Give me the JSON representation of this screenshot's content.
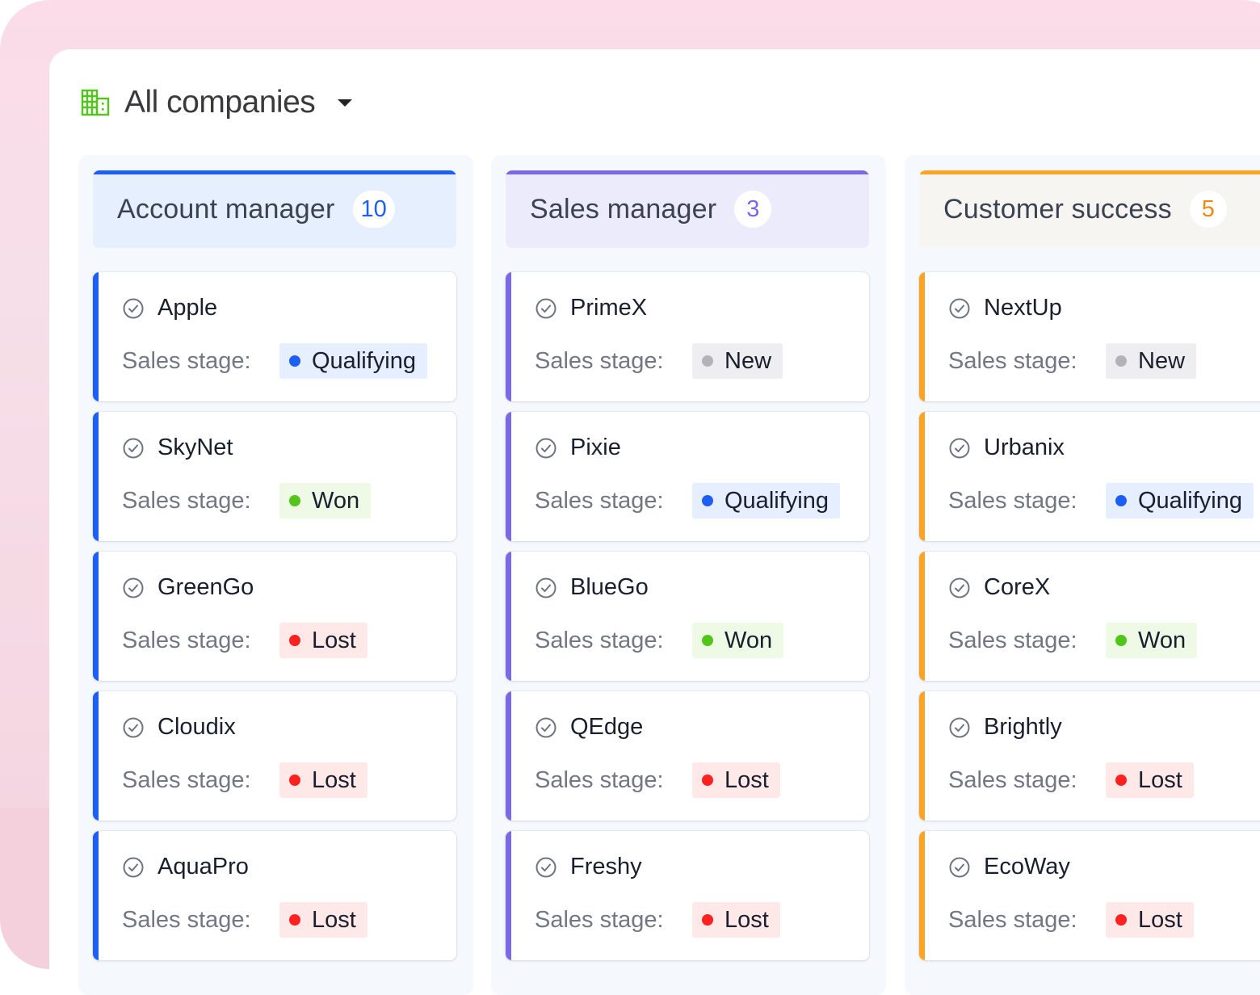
{
  "header": {
    "title": "All companies",
    "icon": "building-icon",
    "icon_color": "#52c41a",
    "dropdown_icon": "caret-down-icon"
  },
  "stage_styles": {
    "Qualifying": {
      "dot": "#1d5ef5",
      "bg": "#e6efff"
    },
    "Won": {
      "dot": "#52c41a",
      "bg": "#eefae6"
    },
    "Lost": {
      "dot": "#ff2020",
      "bg": "#ffe8e8"
    },
    "New": {
      "dot": "#b2b3b8",
      "bg": "#eeeef0"
    }
  },
  "columns": [
    {
      "title": "Account manager",
      "count": "10",
      "accent": "#1d5ef5",
      "header_bg": "#e6effe",
      "count_color": "#1d5ef5",
      "cards": [
        {
          "name": "Apple",
          "stage_label": "Sales stage:",
          "stage": "Qualifying"
        },
        {
          "name": "SkyNet",
          "stage_label": "Sales stage:",
          "stage": "Won"
        },
        {
          "name": "GreenGo",
          "stage_label": "Sales stage:",
          "stage": "Lost"
        },
        {
          "name": "Cloudix",
          "stage_label": "Sales stage:",
          "stage": "Lost"
        },
        {
          "name": "AquaPro",
          "stage_label": "Sales stage:",
          "stage": "Lost"
        }
      ]
    },
    {
      "title": "Sales manager",
      "count": "3",
      "accent": "#7a68e6",
      "header_bg": "#ebebfb",
      "count_color": "#7a68e6",
      "cards": [
        {
          "name": "PrimeX",
          "stage_label": "Sales stage:",
          "stage": "New"
        },
        {
          "name": "Pixie",
          "stage_label": "Sales stage:",
          "stage": "Qualifying"
        },
        {
          "name": "BlueGo",
          "stage_label": "Sales stage:",
          "stage": "Won"
        },
        {
          "name": "QEdge",
          "stage_label": "Sales stage:",
          "stage": "Lost"
        },
        {
          "name": "Freshy",
          "stage_label": "Sales stage:",
          "stage": "Lost"
        }
      ]
    },
    {
      "title": "Customer success",
      "count": "5",
      "accent": "#fca421",
      "header_bg": "#f7f5f2",
      "count_color": "#ec8a10",
      "cards": [
        {
          "name": "NextUp",
          "stage_label": "Sales stage:",
          "stage": "New"
        },
        {
          "name": "Urbanix",
          "stage_label": "Sales stage:",
          "stage": "Qualifying"
        },
        {
          "name": "CoreX",
          "stage_label": "Sales stage:",
          "stage": "Won"
        },
        {
          "name": "Brightly",
          "stage_label": "Sales stage:",
          "stage": "Lost"
        },
        {
          "name": "EcoWay",
          "stage_label": "Sales stage:",
          "stage": "Lost"
        }
      ]
    }
  ]
}
